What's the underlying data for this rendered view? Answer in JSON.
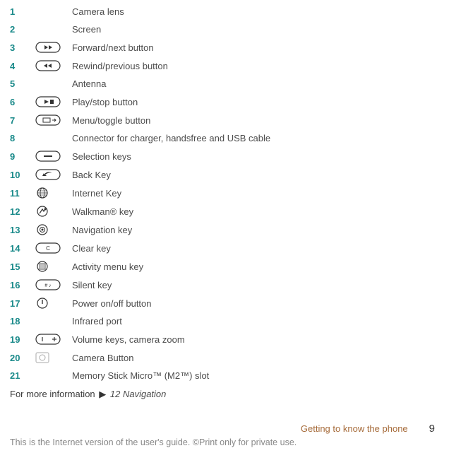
{
  "parts": [
    {
      "num": "1",
      "icon": "",
      "desc": "Camera lens"
    },
    {
      "num": "2",
      "icon": "",
      "desc": "Screen"
    },
    {
      "num": "3",
      "icon": "forward",
      "desc": "Forward/next button"
    },
    {
      "num": "4",
      "icon": "rewind",
      "desc": "Rewind/previous button"
    },
    {
      "num": "5",
      "icon": "",
      "desc": "Antenna"
    },
    {
      "num": "6",
      "icon": "playstop",
      "desc": "Play/stop button"
    },
    {
      "num": "7",
      "icon": "menu",
      "desc": "Menu/toggle button"
    },
    {
      "num": "8",
      "icon": "",
      "desc": "Connector for charger, handsfree and USB cable"
    },
    {
      "num": "9",
      "icon": "selection",
      "desc": "Selection keys"
    },
    {
      "num": "10",
      "icon": "back",
      "desc": "Back Key"
    },
    {
      "num": "11",
      "icon": "internet",
      "desc": "Internet Key"
    },
    {
      "num": "12",
      "icon": "walkman",
      "desc": "Walkman® key"
    },
    {
      "num": "13",
      "icon": "nav",
      "desc": "Navigation key"
    },
    {
      "num": "14",
      "icon": "clear",
      "desc": "Clear key"
    },
    {
      "num": "15",
      "icon": "activity",
      "desc": "Activity menu key"
    },
    {
      "num": "16",
      "icon": "silent",
      "desc": "Silent key"
    },
    {
      "num": "17",
      "icon": "power",
      "desc": "Power on/off button"
    },
    {
      "num": "18",
      "icon": "",
      "desc": "Infrared port"
    },
    {
      "num": "19",
      "icon": "volume",
      "desc": "Volume keys, camera zoom"
    },
    {
      "num": "20",
      "icon": "camera",
      "desc": "Camera Button"
    },
    {
      "num": "21",
      "icon": "",
      "desc": "Memory Stick Micro™ (M2™) slot"
    }
  ],
  "moreinfo": {
    "prefix": "For more information ",
    "link": "12 Navigation"
  },
  "footer": {
    "section": "Getting to know the phone",
    "page": "9",
    "notice": "This is the Internet version of the user's guide. ©Print only for private use."
  }
}
